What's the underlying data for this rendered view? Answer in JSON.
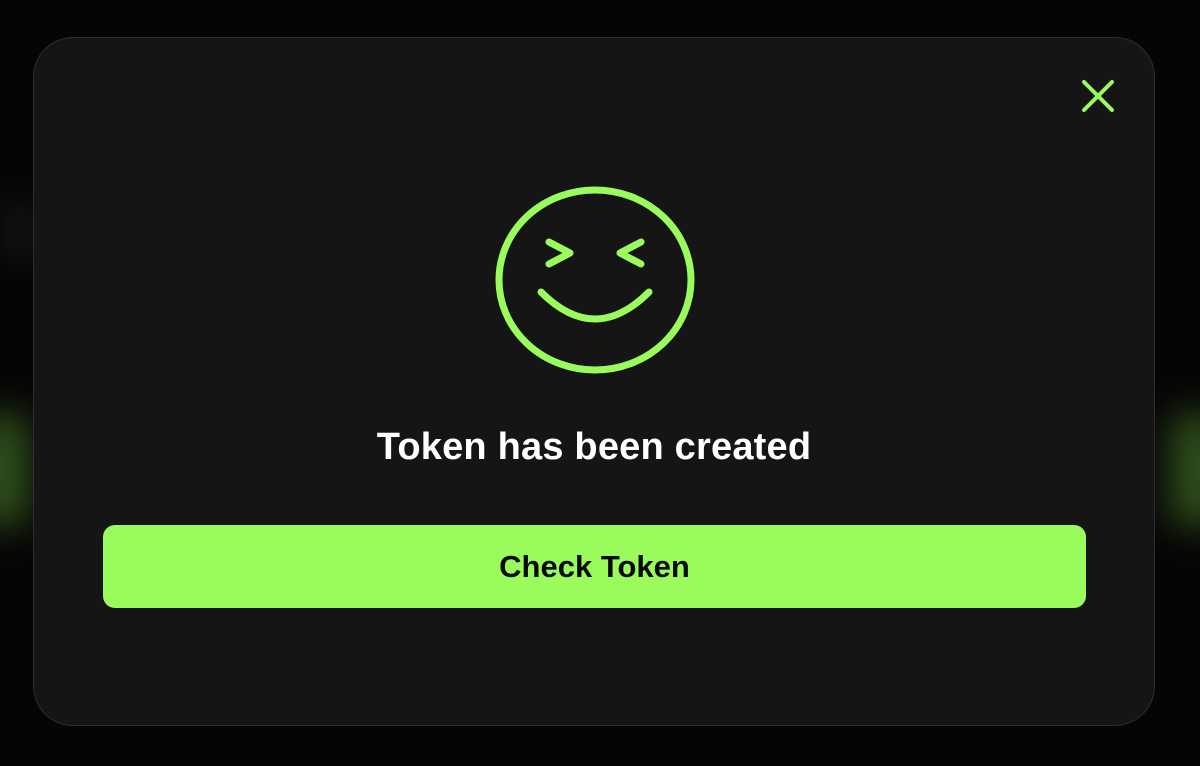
{
  "dialog": {
    "title": "Token has been created",
    "primary_button_label": "Check Token",
    "close_icon": "close-icon",
    "illustration_icon": "grinning-squint-face-icon"
  },
  "colors": {
    "accent": "#9afb5c",
    "modal_background": "#151515",
    "page_background": "#050505",
    "title_text": "#ffffff",
    "button_text": "#0a0a0a"
  }
}
